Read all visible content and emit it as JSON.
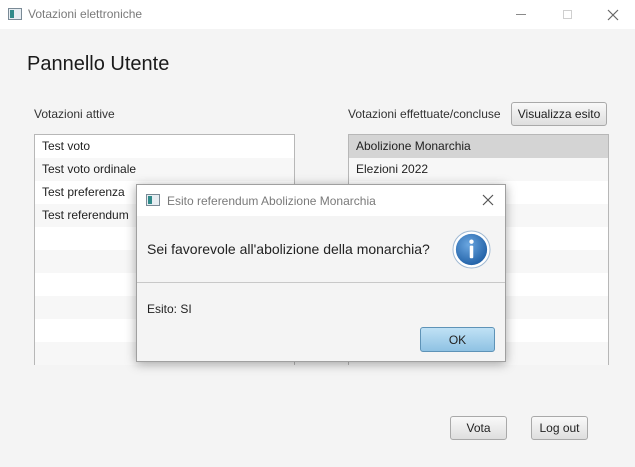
{
  "window": {
    "title": "Votazioni elettroniche"
  },
  "main": {
    "heading": "Pannello Utente",
    "active_label": "Votazioni attive",
    "done_label": "Votazioni effettuate/concluse",
    "show_result_button": "Visualizza esito",
    "vote_button": "Vota",
    "logout_button": "Log out",
    "active_votes": [
      "Test voto",
      "Test voto ordinale",
      "Test preferenza",
      "Test referendum"
    ],
    "done_votes": [
      "Abolizione Monarchia",
      "Elezioni 2022"
    ],
    "done_selected_index": 0
  },
  "dialog": {
    "title": "Esito referendum Abolizione Monarchia",
    "question": "Sei favorevole all'abolizione della monarchia?",
    "result": "Esito: SI",
    "ok_button": "OK",
    "icon": "info-icon"
  },
  "colors": {
    "info_blue": "#2d6fb5",
    "ok_button": "#a9d3ee"
  }
}
